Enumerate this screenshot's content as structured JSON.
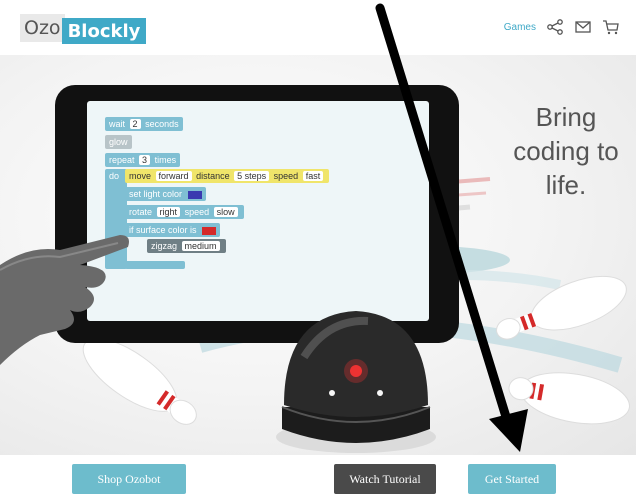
{
  "logo": {
    "part1": "Ozo",
    "part2": "Blockly"
  },
  "header": {
    "games_label": "Games",
    "share_icon": "share-icon",
    "mail_icon": "mail-icon",
    "cart_icon": "cart-icon"
  },
  "tablet_blocks": {
    "wait": "wait",
    "wait_value": "2",
    "seconds": "seconds",
    "glow": "glow",
    "repeat": "repeat",
    "repeat_value": "3",
    "times": "times",
    "do": "do",
    "move": "move",
    "forward": "forward",
    "distance": "distance",
    "steps": "5 steps",
    "speed": "speed",
    "fast": "fast",
    "set_light": "set light color",
    "rotate": "rotate",
    "right": "right",
    "rotate_speed": "speed",
    "slow": "slow",
    "if_surface": "if surface color is",
    "zigzag": "zigzag",
    "medium": "medium"
  },
  "hero": {
    "tagline": [
      "Bring",
      "coding to",
      "life."
    ]
  },
  "buttons": {
    "shop": "Shop Ozobot",
    "watch": "Watch Tutorial",
    "start": "Get Started"
  },
  "colors": {
    "accent": "#3fa9c7",
    "button_teal": "#6dbccc",
    "button_dark": "#4a4a4a"
  }
}
